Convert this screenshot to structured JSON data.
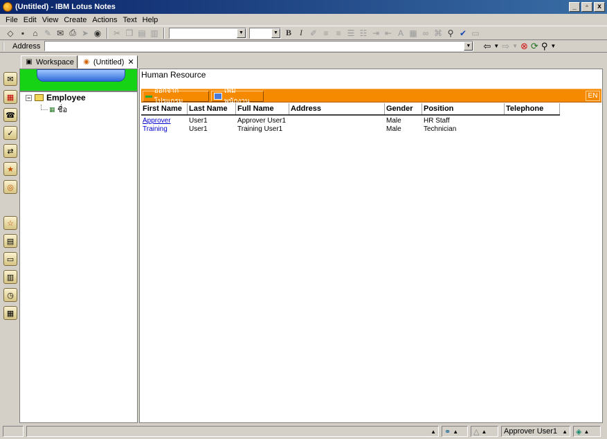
{
  "window": {
    "title": "(Untitled) - IBM Lotus Notes",
    "controls": [
      "_",
      "▫",
      "x"
    ]
  },
  "menu": [
    "File",
    "Edit",
    "View",
    "Create",
    "Actions",
    "Text",
    "Help"
  ],
  "address": {
    "label": "Address",
    "value": ""
  },
  "tabs": [
    {
      "label": "Workspace",
      "active": false
    },
    {
      "label": "(Untitled)",
      "active": true
    }
  ],
  "nav": {
    "root_label": "Employee",
    "child_label": "ชื่อ"
  },
  "view": {
    "title": "Human Resource",
    "actions": [
      {
        "label": "ออกจากโปรแกรม"
      },
      {
        "label": "เพิ่มพนักงาน"
      }
    ],
    "lang_badge": "EN",
    "columns": [
      "First Name",
      "Last Name",
      "Full Name",
      "Address",
      "Gender",
      "Position",
      "Telephone"
    ],
    "rows": [
      [
        "Approver",
        "User1",
        "Approver User1",
        "",
        "Male",
        "HR Staff",
        ""
      ],
      [
        "Training",
        "User1",
        "Training User1",
        "",
        "Male",
        "Technician",
        ""
      ]
    ]
  },
  "status": {
    "user": "Approver User1"
  },
  "colors": {
    "title_bar": "#0a246a",
    "action_bar": "#f58a00",
    "nav_banner": "#16d316",
    "link": "#0000cc"
  }
}
